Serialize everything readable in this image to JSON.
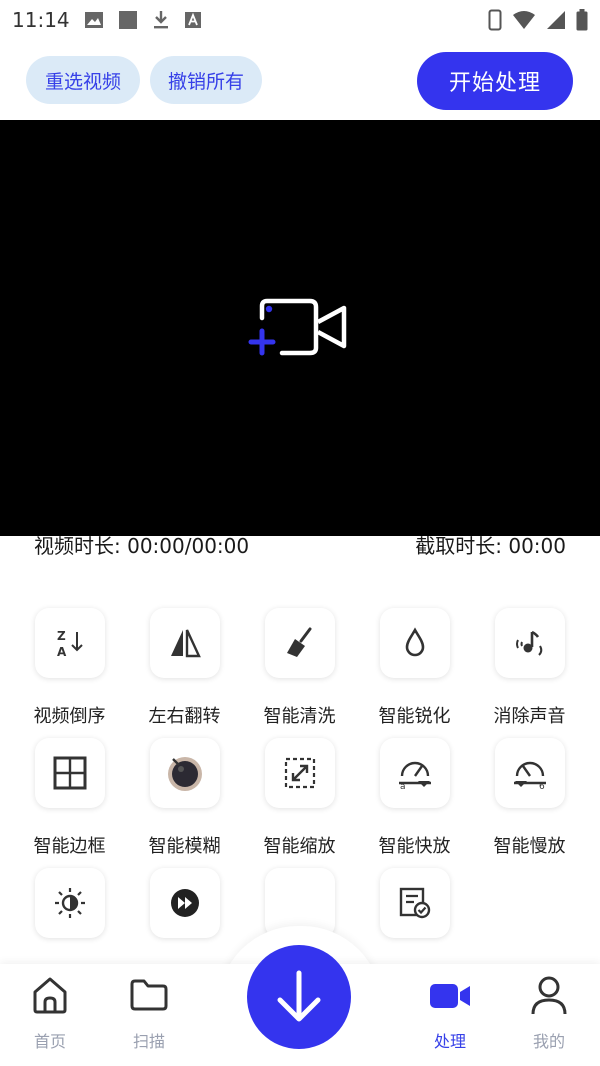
{
  "status_bar": {
    "time": "11:14",
    "icons_left": [
      "image-icon",
      "square-icon",
      "download-icon",
      "a-badge-icon"
    ],
    "icons_right": [
      "phone-icon",
      "wifi-icon",
      "signal-icon",
      "battery-icon"
    ]
  },
  "toolbar": {
    "reselect_label": "重选视频",
    "undo_label": "撤销所有",
    "start_label": "开始处理"
  },
  "video": {
    "add_icon": "add-video-icon",
    "duration_label": "视频时长: 00:00/00:00",
    "clip_label": "截取时长: 00:00"
  },
  "tools": [
    {
      "label": "视频倒序",
      "icon": "sort-reverse-icon"
    },
    {
      "label": "左右翻转",
      "icon": "flip-horizontal-icon"
    },
    {
      "label": "智能清洗",
      "icon": "broom-icon"
    },
    {
      "label": "智能锐化",
      "icon": "drop-icon"
    },
    {
      "label": "消除声音",
      "icon": "mute-note-icon"
    },
    {
      "label": "智能边框",
      "icon": "frame-grid-icon"
    },
    {
      "label": "智能模糊",
      "icon": "blur-lens-icon"
    },
    {
      "label": "智能缩放",
      "icon": "scale-icon"
    },
    {
      "label": "智能快放",
      "icon": "speed-up-icon"
    },
    {
      "label": "智能慢放",
      "icon": "slow-down-icon"
    },
    {
      "label": "",
      "icon": "brightness-icon"
    },
    {
      "label": "",
      "icon": "fast-forward-icon"
    },
    {
      "label": "",
      "icon": "blank-icon"
    },
    {
      "label": "",
      "icon": "subtitle-check-icon"
    }
  ],
  "nav": {
    "home_label": "首页",
    "scan_label": "扫描",
    "process_label": "处理",
    "mine_label": "我的",
    "active": "处理",
    "fab_icon": "arrow-down-icon"
  },
  "colors": {
    "accent": "#3434ee",
    "pill_bg": "#dbeaf7",
    "inactive": "#9aa0b0"
  }
}
